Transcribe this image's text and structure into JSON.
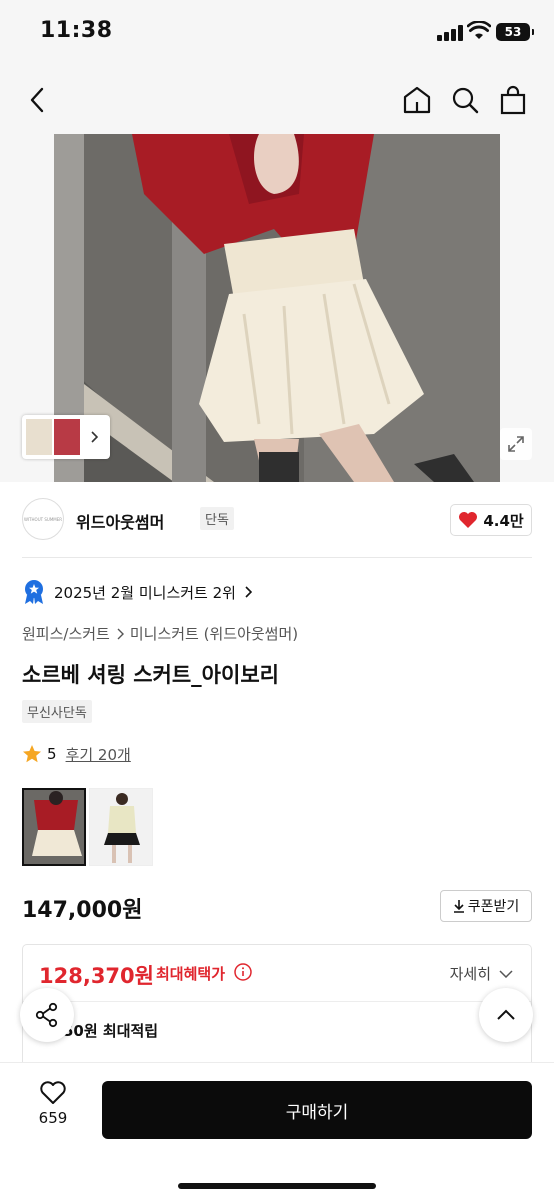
{
  "status_bar": {
    "time": "11:38",
    "battery": "53"
  },
  "header": {
    "icons": [
      "back-icon",
      "home-icon",
      "search-icon",
      "bag-icon"
    ]
  },
  "brand": {
    "name": "위드아웃썸머",
    "badge": "단독",
    "likes": "4.4만"
  },
  "ranking": {
    "text": "2025년 2월 미니스커트 2위"
  },
  "breadcrumb": {
    "category": "원피스/스커트",
    "subcategory": "미니스커트 (위드아웃썸머)"
  },
  "product": {
    "title": "소르베 셔링 스커트_아이보리",
    "badge": "무신사단독",
    "rating": "5",
    "reviews": "후기 20개",
    "price": "147,000원"
  },
  "coupon": {
    "label": "쿠폰받기"
  },
  "benefit": {
    "price": "128,370원",
    "label": "최대혜택가",
    "detail": "자세히",
    "points": "50원 최대적립"
  },
  "bottom": {
    "like_count": "659",
    "buy_label": "구매하기"
  },
  "colors": {
    "sale_red": "#e0262e",
    "rank_blue": "#1f6fe0",
    "star": "#f5a623"
  }
}
